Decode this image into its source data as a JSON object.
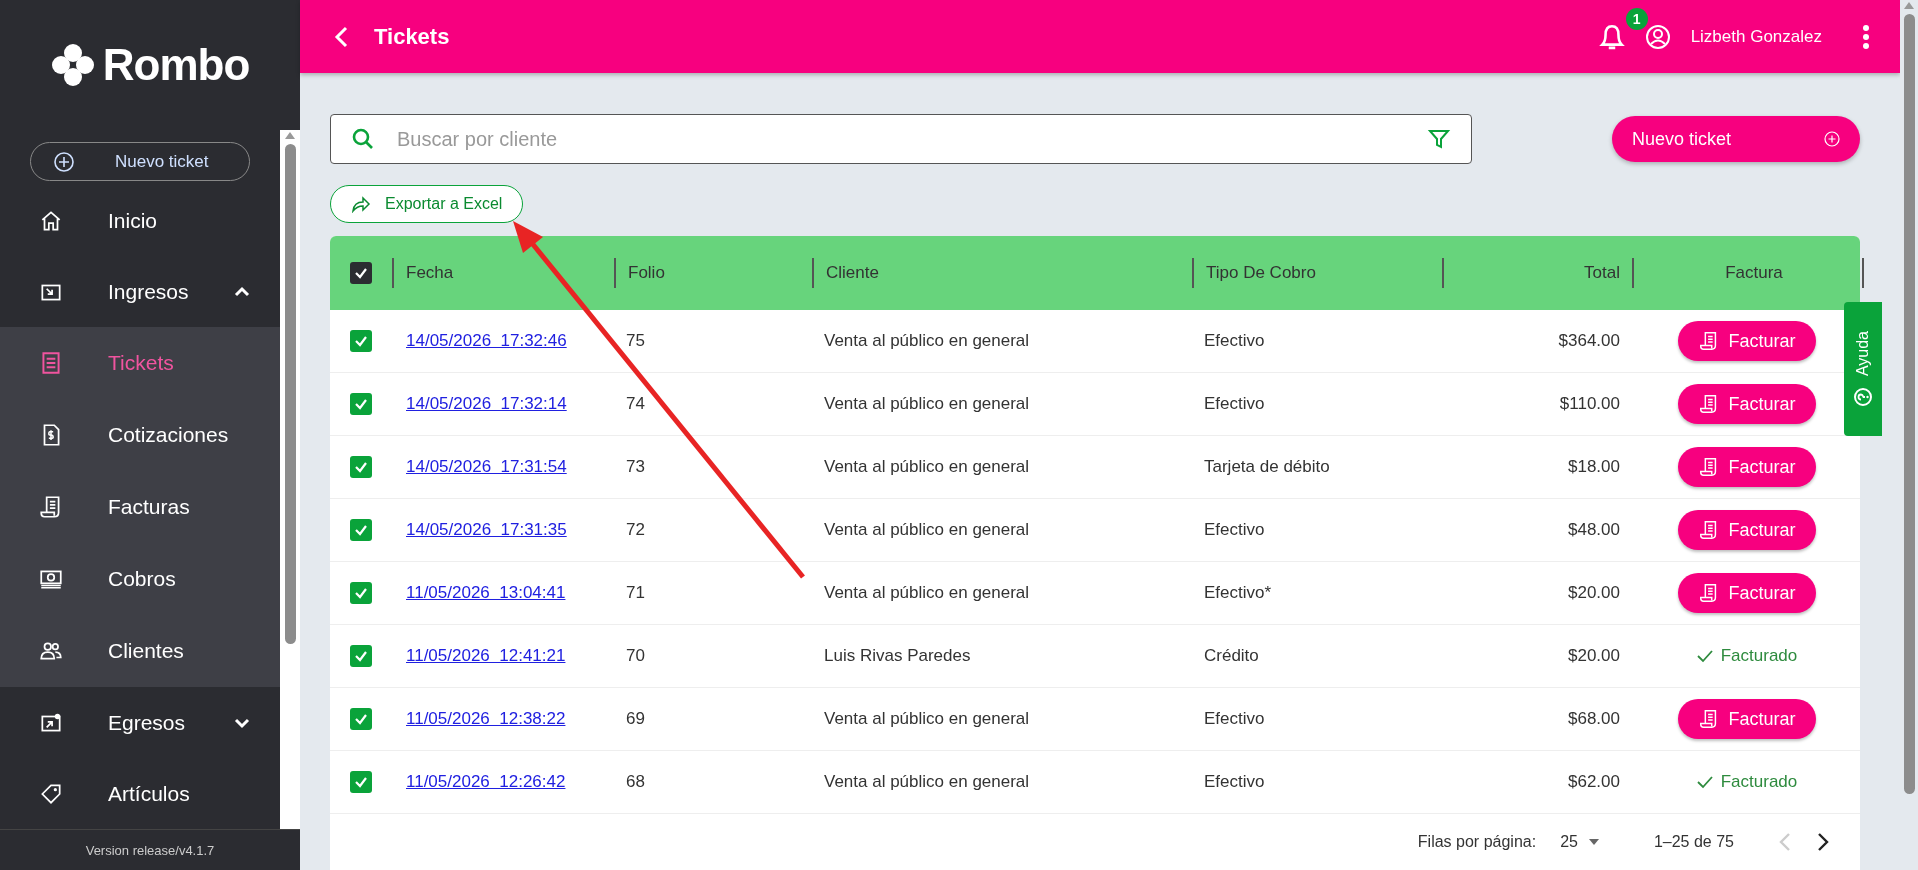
{
  "brand": "Rombo",
  "sidebar": {
    "new_button": "Nuevo ticket",
    "items": [
      {
        "label": "Inicio",
        "selected": false
      },
      {
        "label": "Ingresos",
        "selected": false,
        "expanded": true,
        "children": [
          {
            "label": "Tickets",
            "selected": true
          },
          {
            "label": "Cotizaciones",
            "selected": false
          },
          {
            "label": "Facturas",
            "selected": false
          },
          {
            "label": "Cobros",
            "selected": false
          },
          {
            "label": "Clientes",
            "selected": false
          }
        ]
      },
      {
        "label": "Egresos",
        "selected": false,
        "expanded": false
      },
      {
        "label": "Artículos",
        "selected": false
      }
    ],
    "version": "Version release/v4.1.7"
  },
  "header": {
    "title": "Tickets",
    "notifications": "1",
    "user": "Lizbeth Gonzalez"
  },
  "search": {
    "placeholder": "Buscar por cliente"
  },
  "new_ticket_button": "Nuevo ticket",
  "export_button": "Exportar a Excel",
  "help_tab": "Ayuda",
  "table": {
    "select_all_checked": true,
    "columns": [
      "Fecha",
      "Folio",
      "Cliente",
      "Tipo De Cobro",
      "Total",
      "Factura"
    ],
    "rows": [
      {
        "checked": true,
        "fecha": "14/05/2026  17:32:46",
        "folio": "75",
        "cliente": "Venta al público en general",
        "tipo": "Efectivo",
        "total": "$364.00",
        "factura": {
          "kind": "button",
          "label": "Facturar"
        }
      },
      {
        "checked": true,
        "fecha": "14/05/2026  17:32:14",
        "folio": "74",
        "cliente": "Venta al público en general",
        "tipo": "Efectivo",
        "total": "$110.00",
        "factura": {
          "kind": "button",
          "label": "Facturar"
        }
      },
      {
        "checked": true,
        "fecha": "14/05/2026  17:31:54",
        "folio": "73",
        "cliente": "Venta al público en general",
        "tipo": "Tarjeta de débito",
        "total": "$18.00",
        "factura": {
          "kind": "button",
          "label": "Facturar"
        }
      },
      {
        "checked": true,
        "fecha": "14/05/2026  17:31:35",
        "folio": "72",
        "cliente": "Venta al público en general",
        "tipo": "Efectivo",
        "total": "$48.00",
        "factura": {
          "kind": "button",
          "label": "Facturar"
        }
      },
      {
        "checked": true,
        "fecha": "11/05/2026  13:04:41",
        "folio": "71",
        "cliente": "Venta al público en general",
        "tipo": "Efectivo*",
        "total": "$20.00",
        "factura": {
          "kind": "button",
          "label": "Facturar"
        }
      },
      {
        "checked": true,
        "fecha": "11/05/2026  12:41:21",
        "folio": "70",
        "cliente": "Luis Rivas Paredes",
        "tipo": "Crédito",
        "total": "$20.00",
        "factura": {
          "kind": "done",
          "label": "Facturado"
        }
      },
      {
        "checked": true,
        "fecha": "11/05/2026  12:38:22",
        "folio": "69",
        "cliente": "Venta al público en general",
        "tipo": "Efectivo",
        "total": "$68.00",
        "factura": {
          "kind": "button",
          "label": "Facturar"
        }
      },
      {
        "checked": true,
        "fecha": "11/05/2026  12:26:42",
        "folio": "68",
        "cliente": "Venta al público en general",
        "tipo": "Efectivo",
        "total": "$62.00",
        "factura": {
          "kind": "done",
          "label": "Facturado"
        }
      }
    ]
  },
  "pagination": {
    "rows_label": "Filas por página:",
    "rows_value": "25",
    "range": "1–25 de 75"
  }
}
